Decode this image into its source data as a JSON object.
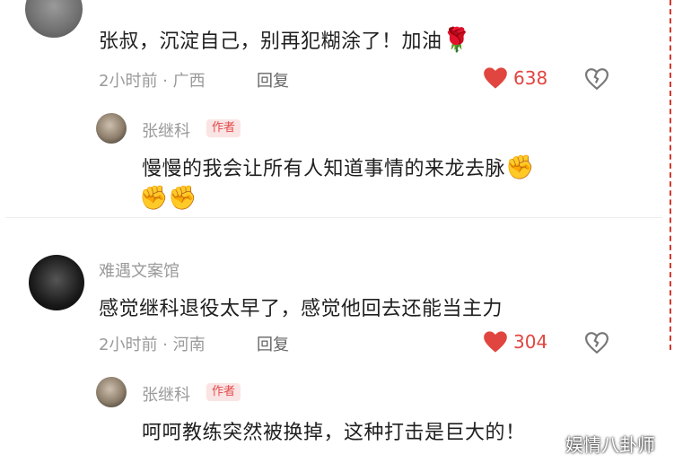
{
  "comments": [
    {
      "text": "张叔，沉淀自己，别再犯糊涂了！加油",
      "emoji_end": "🌹",
      "time": "2小时前",
      "region": "广西",
      "reply_label": "回复",
      "likes": "638",
      "reply": {
        "username": "张继科",
        "badge": "作者",
        "text": "慢慢的我会让所有人知道事情的来龙去脉",
        "emoji_a": "✊",
        "emoji_b": "✊",
        "emoji_c": "✊"
      }
    },
    {
      "username": "难遇文案馆",
      "text": "感觉继科退役太早了，感觉他回去还能当主力",
      "time": "2小时前",
      "region": "河南",
      "reply_label": "回复",
      "likes": "304",
      "reply": {
        "username": "张继科",
        "badge": "作者",
        "text": "呵呵教练突然被换掉，这种打击是巨大的！"
      }
    }
  ],
  "separator": "·",
  "watermark": "娱情八卦师",
  "colors": {
    "like": "#e1453f",
    "badge_bg": "#fbe4e4",
    "badge_text": "#e34a4a"
  }
}
